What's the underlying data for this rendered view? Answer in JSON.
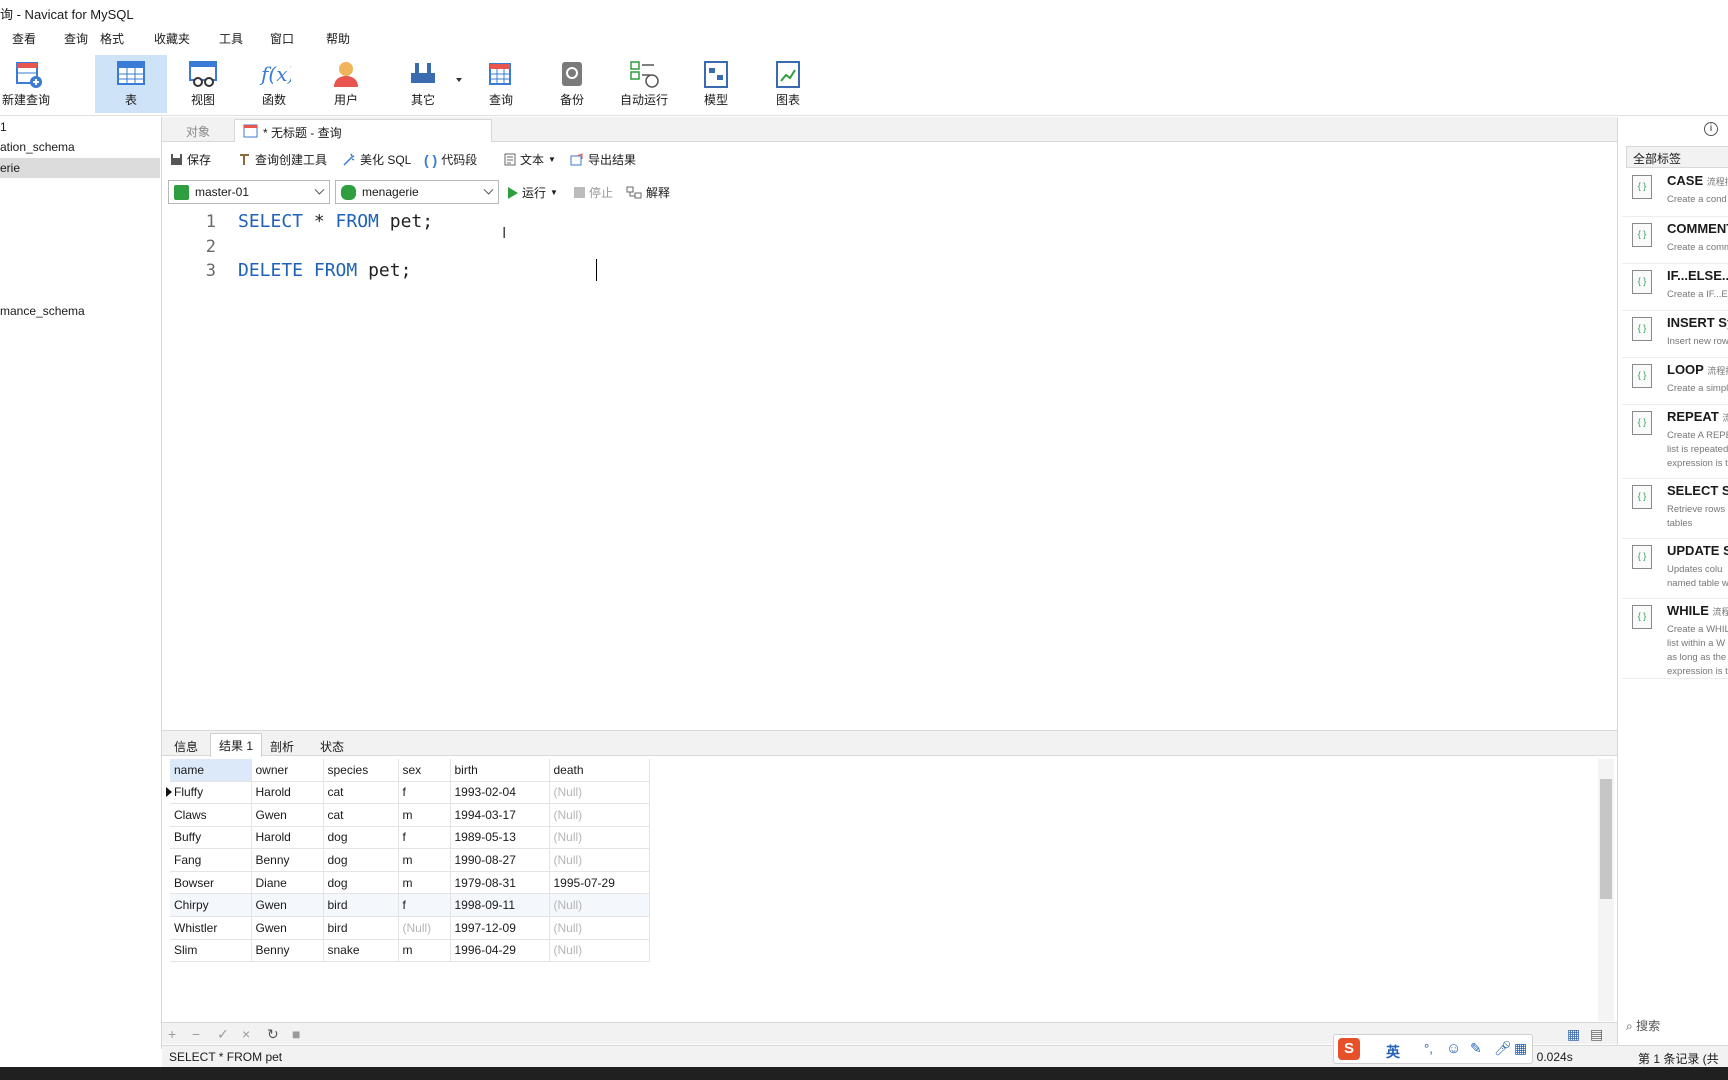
{
  "window": {
    "title": "询 - Navicat for MySQL"
  },
  "menu": [
    "查看",
    "查询",
    "格式",
    "收藏夹",
    "工具",
    "窗口",
    "帮助"
  ],
  "toolbar": [
    {
      "label": "新建查询",
      "icon": "new-query-icon"
    },
    {
      "label": "表",
      "icon": "table-icon"
    },
    {
      "label": "视图",
      "icon": "view-icon"
    },
    {
      "label": "函数",
      "icon": "function-icon"
    },
    {
      "label": "用户",
      "icon": "user-icon"
    },
    {
      "label": "其它",
      "icon": "tools-icon"
    },
    {
      "label": "查询",
      "icon": "query-icon"
    },
    {
      "label": "备份",
      "icon": "backup-icon"
    },
    {
      "label": "自动运行",
      "icon": "schedule-icon"
    },
    {
      "label": "模型",
      "icon": "model-icon"
    },
    {
      "label": "图表",
      "icon": "chart-icon"
    }
  ],
  "sidebar": [
    "1",
    "ation_schema",
    "erie",
    "mance_schema"
  ],
  "tabs": {
    "objects": "对象",
    "query": "* 无标题 - 查询"
  },
  "query_toolbar": {
    "save": "保存",
    "builder": "查询创建工具",
    "beautify": "美化 SQL",
    "snippet": "代码段",
    "text": "文本",
    "export": "导出结果"
  },
  "connection": {
    "server": "master-01",
    "database": "menagerie",
    "run": "运行",
    "stop": "停止",
    "explain": "解释"
  },
  "editor": {
    "line_numbers": [
      "1",
      "2",
      "3"
    ],
    "lines": [
      {
        "kw1": "SELECT",
        "mid": " * ",
        "kw2": "FROM",
        "rest": " pet;"
      },
      {
        "kw1": "",
        "mid": "",
        "kw2": "",
        "rest": ""
      },
      {
        "kw1": "DELETE",
        "mid": " ",
        "kw2": "FROM",
        "rest": " pet;"
      }
    ]
  },
  "result_tabs": [
    "信息",
    "结果 1",
    "剖析",
    "状态"
  ],
  "result": {
    "columns": [
      "name",
      "owner",
      "species",
      "sex",
      "birth",
      "death"
    ],
    "rows": [
      [
        "Fluffy",
        "Harold",
        "cat",
        "f",
        "1993-02-04",
        "(Null)"
      ],
      [
        "Claws",
        "Gwen",
        "cat",
        "m",
        "1994-03-17",
        "(Null)"
      ],
      [
        "Buffy",
        "Harold",
        "dog",
        "f",
        "1989-05-13",
        "(Null)"
      ],
      [
        "Fang",
        "Benny",
        "dog",
        "m",
        "1990-08-27",
        "(Null)"
      ],
      [
        "Bowser",
        "Diane",
        "dog",
        "m",
        "1979-08-31",
        "1995-07-29"
      ],
      [
        "Chirpy",
        "Gwen",
        "bird",
        "f",
        "1998-09-11",
        "(Null)"
      ],
      [
        "Whistler",
        "Gwen",
        "bird",
        "(Null)",
        "1997-12-09",
        "(Null)"
      ],
      [
        "Slim",
        "Benny",
        "snake",
        "m",
        "1996-04-29",
        "(Null)"
      ]
    ]
  },
  "status": {
    "sql": "SELECT * FROM pet",
    "time": ": 0.024s",
    "records": "第 1 条记录 (共"
  },
  "right_panel": {
    "filter": "全部标签",
    "search_placeholder": "搜索",
    "snippets": [
      {
        "title": "CASE",
        "tag": "流程控",
        "desc": "Create a cond"
      },
      {
        "title": "COMMENT",
        "tag": "",
        "desc": "Create a comm"
      },
      {
        "title": "IF...ELSE...",
        "tag": "",
        "desc": "Create a IF...EL"
      },
      {
        "title": "INSERT Sy",
        "tag": "",
        "desc": "Insert new row"
      },
      {
        "title": "LOOP",
        "tag": "流程控",
        "desc": "Create a simpl"
      },
      {
        "title": "REPEAT",
        "tag": "流",
        "desc": "Create A REPE\nlist is repeated\nexpression is t"
      },
      {
        "title": "SELECT Sy",
        "tag": "",
        "desc": "Retrieve rows\ntables"
      },
      {
        "title": "UPDATE S",
        "tag": "",
        "desc": "Updates colu\nnamed table w"
      },
      {
        "title": "WHILE",
        "tag": "流程",
        "desc": "Create a WHIL\nlist within a W\nas long as the\nexpression is t"
      }
    ]
  },
  "ime": {
    "lang": "英"
  },
  "colors": {
    "accent": "#1f62b8",
    "selected_tool": "#cfe3f8",
    "run_green": "#2e9e3e"
  }
}
